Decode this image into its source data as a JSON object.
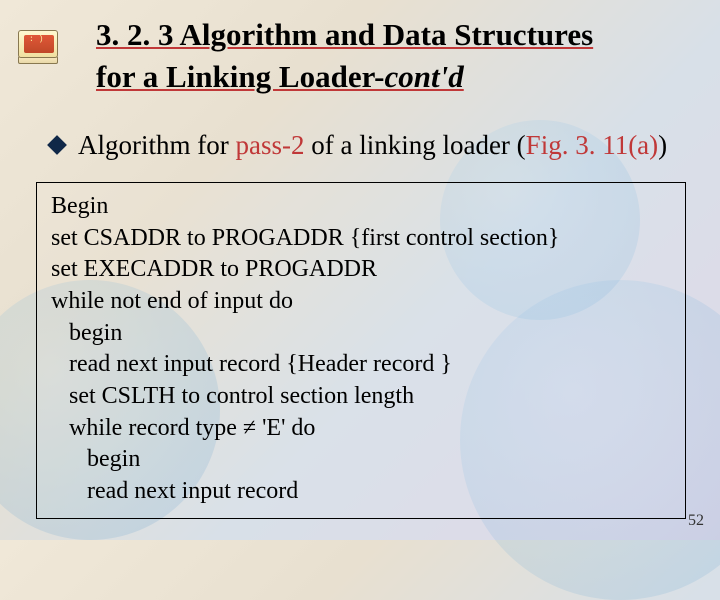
{
  "title_line1": "3. 2. 3 Algorithm and Data Structures",
  "title_line2_prefix": "for a Linking Loader-",
  "title_line2_contd": "cont'd",
  "bullet_text_before": "Algorithm for ",
  "bullet_red1": "pass-2",
  "bullet_text_mid": " of a linking loader (",
  "bullet_red2": "Fig. 3. 11(a)",
  "bullet_text_after": ")",
  "code": "Begin\nset CSADDR to PROGADDR {first control section}\nset EXECADDR to PROGADDR\nwhile not end of input do\n   begin\n   read next input record {Header record }\n   set CSLTH to control section length\n   while record type ≠ 'E' do\n      begin\n      read next input record",
  "page_number": "52"
}
